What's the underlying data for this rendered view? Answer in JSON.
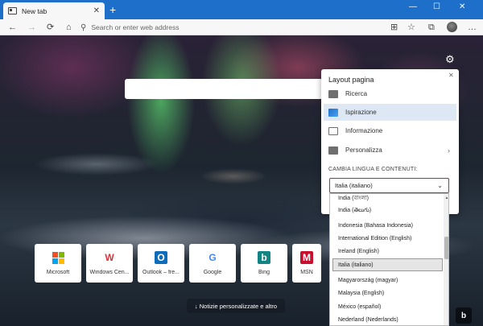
{
  "tab": {
    "title": "New tab",
    "icon": "tab-page-icon",
    "close": "✕"
  },
  "window": {
    "new_tab": "+",
    "minimize": "—",
    "maximize": "☐",
    "close": "✕"
  },
  "nav": {
    "back": "←",
    "forward": "→",
    "refresh": "⟳",
    "home": "⌂",
    "search_icon": "⚲",
    "placeholder": "Search or enter web address"
  },
  "toolbar": {
    "read_aloud": "⊞",
    "favorite": "☆",
    "collections": "⧉",
    "more": "…"
  },
  "page": {
    "settings_icon": "gear-icon",
    "settings_glyph": "⚙"
  },
  "quick_links": [
    {
      "label": "Microsoft",
      "icon": "microsoft-logo-icon"
    },
    {
      "label": "Windows Cen...",
      "icon": "windows-central-icon",
      "glyph": "W",
      "color": "#d8353a"
    },
    {
      "label": "Outlook – fre...",
      "icon": "outlook-icon",
      "glyph": "O",
      "color": "#0f6cbd"
    },
    {
      "label": "Google",
      "icon": "google-icon",
      "glyph": "G",
      "color": "#4285f4"
    },
    {
      "label": "Bing",
      "icon": "bing-icon",
      "glyph": "b",
      "color": "#138484"
    },
    {
      "label": "MSN",
      "icon": "msn-icon",
      "glyph": "M",
      "color": "#c8102e"
    }
  ],
  "news_button": "↓  Notizie personalizzate e altro",
  "bing_button": "b",
  "layout_panel": {
    "title": "Layout pagina",
    "close": "✕",
    "options": [
      {
        "label": "Ricerca",
        "icon": "layout-focused-icon",
        "selected": false
      },
      {
        "label": "Ispirazione",
        "icon": "layout-inspirational-icon",
        "selected": true
      },
      {
        "label": "Informazione",
        "icon": "layout-informational-icon",
        "selected": false
      },
      {
        "label": "Personalizza",
        "icon": "pencil-icon",
        "selected": false,
        "chevron": "›"
      }
    ],
    "section_label": "CAMBIA LINGUA E CONTENUTI:",
    "selected_language": "Italia (italiano)",
    "dropdown_glyph": "⌄"
  },
  "language_list": [
    "India (বাংলা)",
    "India (తెలుగు)",
    "Indonesia (Bahasa Indonesia)",
    "International Edition (English)",
    "Ireland (English)",
    "Italia (italiano)",
    "Magyarország (magyar)",
    "Malaysia (English)",
    "México (español)",
    "Nederland (Nederlands)"
  ],
  "language_highlighted_index": 5
}
